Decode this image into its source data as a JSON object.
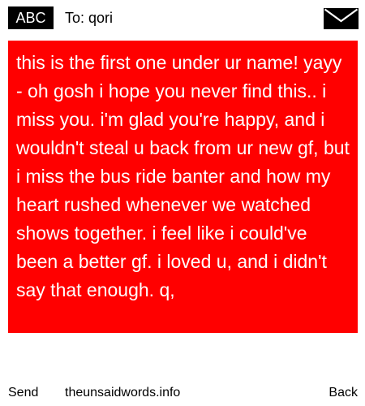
{
  "header": {
    "badge": "ABC",
    "to_label": "To:",
    "recipient": "qori",
    "icon": "envelope-icon"
  },
  "message": {
    "text": "this is the first one under ur name! yayy - oh gosh i hope you never find this.. i miss you. i'm glad you're happy, and i wouldn't steal u back from ur new gf, but i miss the bus ride banter and how my heart rushed whenever we watched shows together. i feel like i could've been a better gf. i loved u, and i didn't say that enough. q,"
  },
  "footer": {
    "send_label": "Send",
    "site": "theunsaidwords.info",
    "back_label": "Back"
  },
  "colors": {
    "message_background": "#ff0000",
    "message_text": "#ffffff",
    "badge_background": "#000000"
  }
}
